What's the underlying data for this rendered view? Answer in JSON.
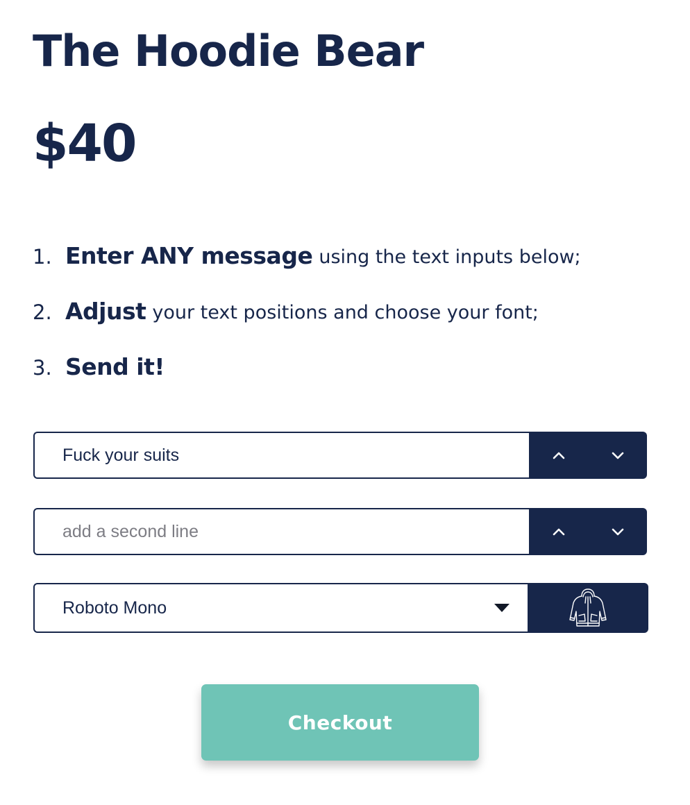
{
  "product": {
    "title": "The Hoodie Bear",
    "price": "$40"
  },
  "instructions": [
    {
      "number": "1.",
      "bold": "Enter ANY message",
      "rest": "using the text inputs below;"
    },
    {
      "number": "2.",
      "bold": "Adjust",
      "rest": "your text positions and choose your font;"
    },
    {
      "number": "3.",
      "bold": "Send it!",
      "rest": ""
    }
  ],
  "line1": {
    "value": "Fuck your suits",
    "placeholder": "",
    "up_icon": "chevron-up-icon",
    "down_icon": "chevron-down-icon"
  },
  "line2": {
    "value": "",
    "placeholder": "add a second line",
    "up_icon": "chevron-up-icon",
    "down_icon": "chevron-down-icon"
  },
  "font_select": {
    "selected": "Roboto Mono",
    "caret_icon": "caret-down-icon",
    "preview_icon": "hoodie-icon"
  },
  "checkout": {
    "label": "Checkout"
  },
  "colors": {
    "navy": "#17264a",
    "teal": "#6fc4b6",
    "placeholder_gray": "#7d7d84",
    "background": "#ffffff"
  }
}
